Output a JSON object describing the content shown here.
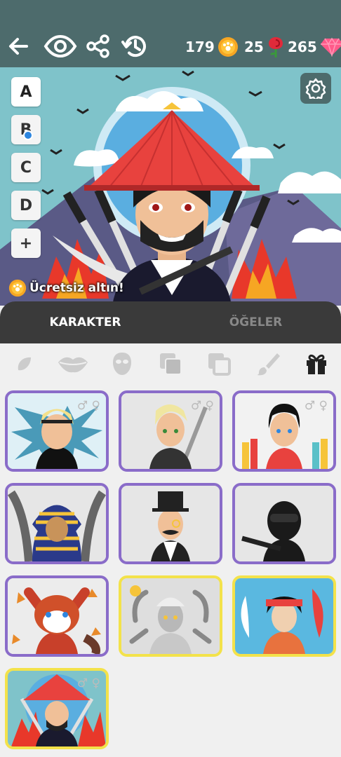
{
  "currencies": {
    "coins": "179",
    "roses": "25",
    "gems": "265"
  },
  "slots": [
    "A",
    "B",
    "C",
    "D",
    "+"
  ],
  "promo": {
    "free_gold_label": "Ücretsiz altın!"
  },
  "tabs": [
    {
      "label": "KARAKTER",
      "active": true
    },
    {
      "label": "ÖĞELER",
      "active": false
    }
  ],
  "categories": [
    "skin-icon",
    "lips-icon",
    "mask-icon",
    "layers-icon",
    "copy-icon",
    "brush-icon",
    "gift-icon"
  ],
  "characters": [
    {
      "name": "ice-spiky",
      "genders": "♂ ♀",
      "border": "#8a6cc9"
    },
    {
      "name": "blonde-swordsman",
      "genders": "♂ ♀",
      "border": "#8a6cc9"
    },
    {
      "name": "black-hair-kid",
      "genders": "♂ ♀",
      "border": "#8a6cc9"
    },
    {
      "name": "pharaoh",
      "genders": "",
      "border": "#8a6cc9"
    },
    {
      "name": "gentleman",
      "genders": "",
      "border": "#8a6cc9"
    },
    {
      "name": "swat-soldier",
      "genders": "",
      "border": "#8a6cc9"
    },
    {
      "name": "red-panda",
      "genders": "",
      "border": "#8a6cc9"
    },
    {
      "name": "cyborg",
      "genders": "",
      "border": "#f3e24a"
    },
    {
      "name": "koi-geisha",
      "genders": "",
      "border": "#f3e24a"
    },
    {
      "name": "ronin",
      "genders": "♂ ♀",
      "border": "#f3e24a"
    }
  ]
}
